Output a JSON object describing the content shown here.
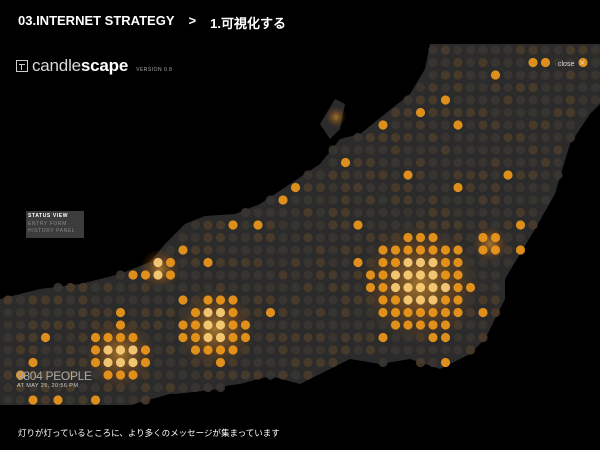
{
  "header": {
    "section": "03.INTERNET STRATEGY",
    "separator": ">",
    "subsection": "1.可視化する"
  },
  "app": {
    "logo_light": "candle",
    "logo_bold": "scape",
    "version": "VERSION 0.8",
    "close_label": "close"
  },
  "panel": {
    "items": [
      "STATUS VIEW",
      "ENTRY FORM",
      "HISTORY PANEL"
    ]
  },
  "status": {
    "count": "9804 PEOPLE",
    "timestamp": "AT MAY 25, 20:56 PM"
  },
  "caption": "灯りが灯っているところに、より多くのメッセージが集まっています",
  "colors": {
    "background": "#000000",
    "land": "#2e2e2e",
    "dot_dim": "#3a3530",
    "dot_orange": "#f29a1a",
    "dot_bright": "#ffd27a"
  }
}
